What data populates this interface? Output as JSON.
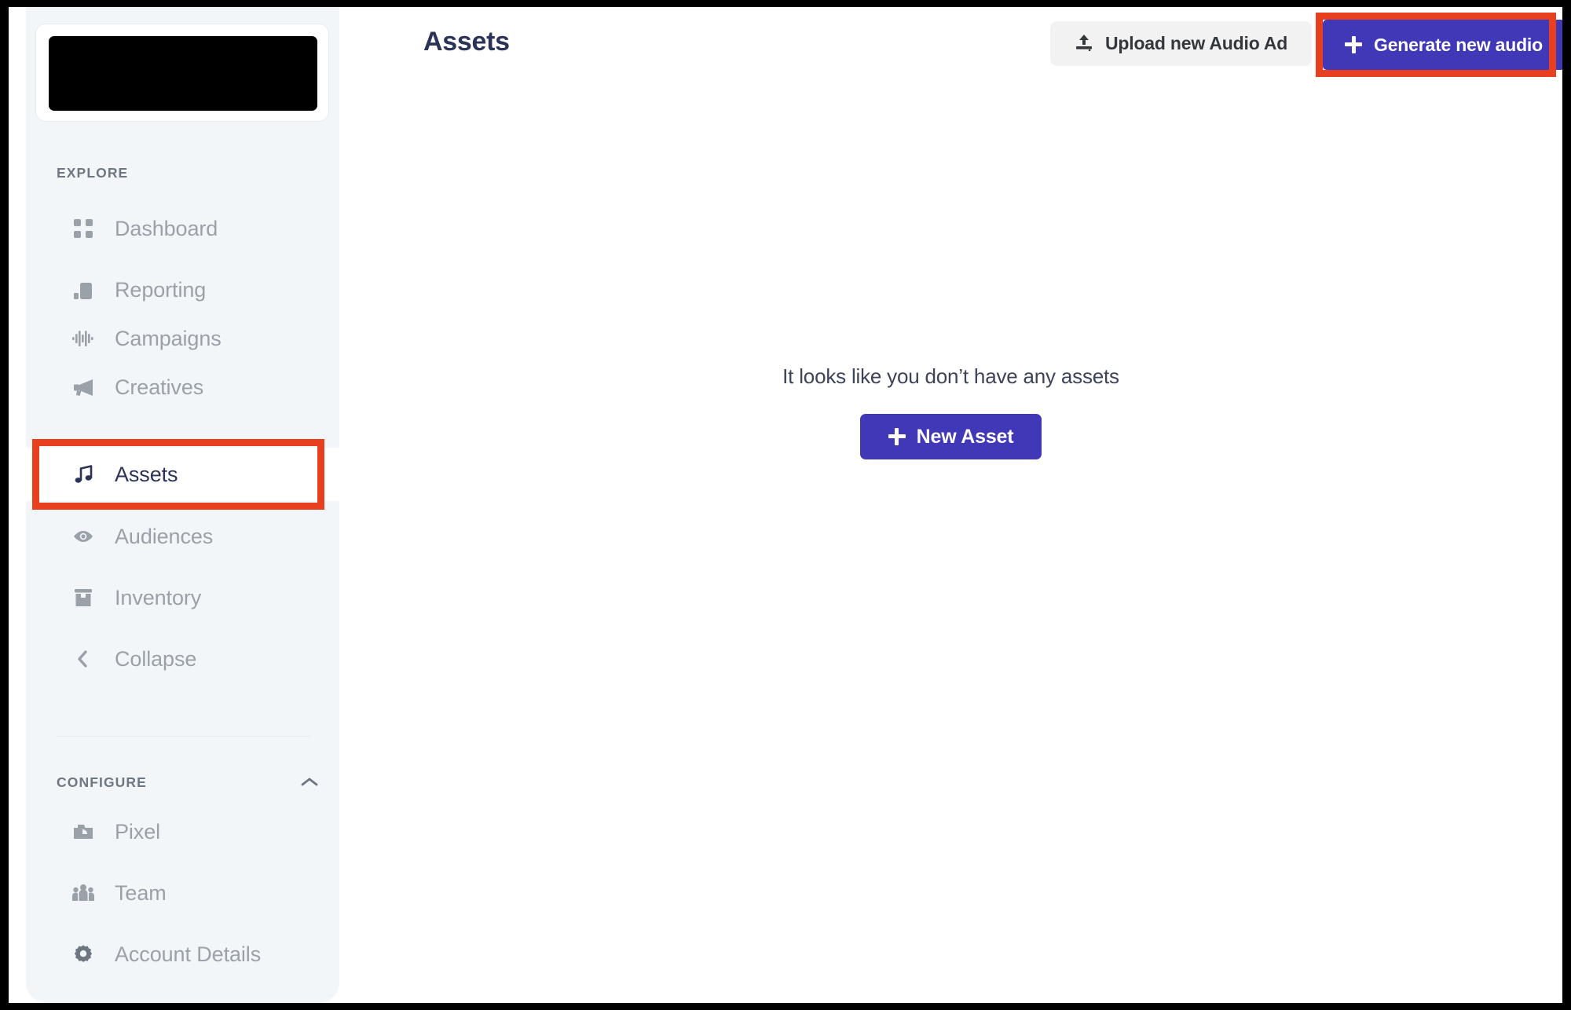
{
  "app": {
    "logo": "redacted-logo-block"
  },
  "sidebar": {
    "sections": [
      {
        "id": "explore",
        "label": "EXPLORE",
        "chevron": null,
        "items": [
          {
            "label": "Dashboard",
            "icon": "grid-dots-icon",
            "active": false
          },
          {
            "label": "Reporting",
            "icon": "bar-chart-icon",
            "active": false
          },
          {
            "label": "Campaigns",
            "icon": "waveform-icon",
            "active": false
          },
          {
            "label": "Creatives",
            "icon": "megaphone-icon",
            "active": false
          },
          {
            "label": "Assets",
            "icon": "music-note-icon",
            "active": true
          },
          {
            "label": "Audiences",
            "icon": "eye-icon",
            "active": false
          },
          {
            "label": "Inventory",
            "icon": "box-icon",
            "active": false
          },
          {
            "label": "Collapse",
            "icon": "chevron-left-icon",
            "active": false
          }
        ]
      },
      {
        "id": "configure",
        "label": "CONFIGURE",
        "chevron": "chevron-up-icon",
        "items": [
          {
            "label": "Pixel",
            "icon": "camera-icon",
            "active": false
          },
          {
            "label": "Team",
            "icon": "people-icon",
            "active": false
          },
          {
            "label": "Account Details",
            "icon": "gear-icon",
            "active": false
          }
        ]
      }
    ]
  },
  "header": {
    "title": "Assets",
    "upload_button": {
      "label": "Upload new Audio Ad",
      "icon": "upload-icon"
    },
    "generate_button": {
      "label": "Generate new audio",
      "icon": "plus-icon"
    }
  },
  "main": {
    "empty_state": {
      "message": "It looks like you don’t have any assets",
      "action_label": "New Asset",
      "action_icon": "plus-icon"
    }
  },
  "annotations": [
    {
      "target": "sidebar-item-assets",
      "color": "#e8401f"
    },
    {
      "target": "generate-new-audio-button",
      "color": "#e8401f"
    }
  ],
  "colors": {
    "accent_indigo": "#4138b8",
    "annotation_red": "#e8401f",
    "sidebar_bg": "#f3f6f8",
    "title_navy": "#2b3357",
    "muted_gray": "#9aa1a9"
  }
}
